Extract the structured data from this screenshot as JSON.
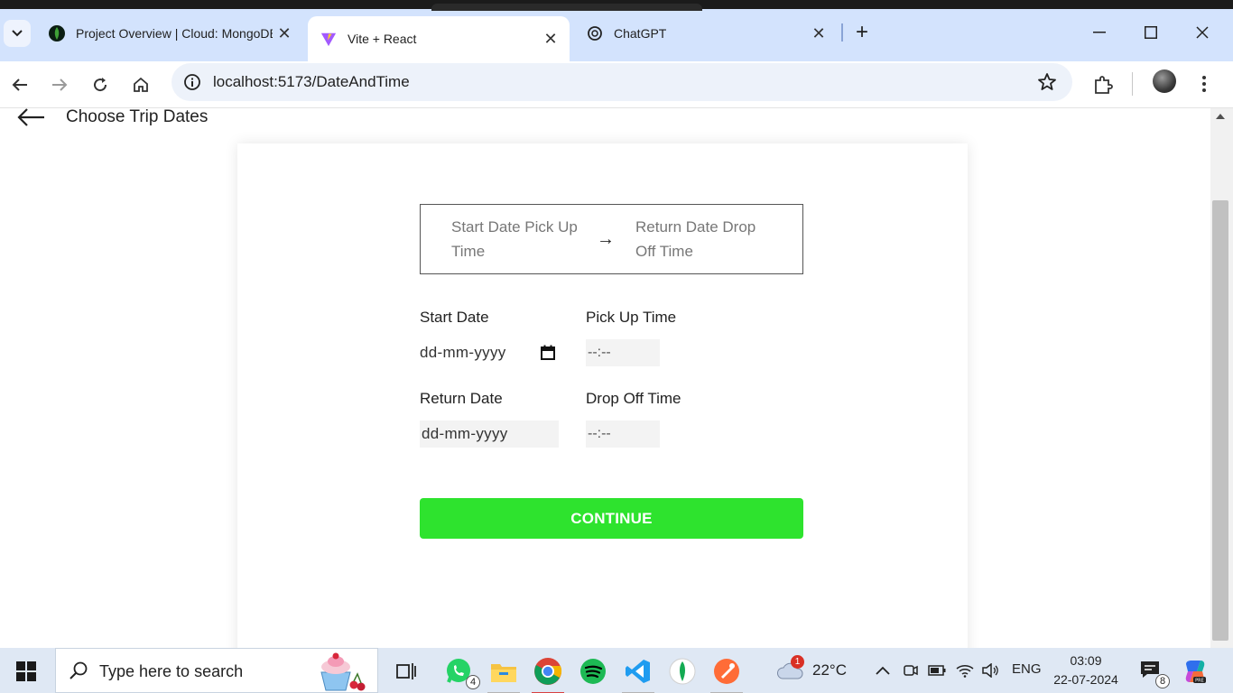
{
  "browser": {
    "tabs": [
      {
        "title": "Project Overview | Cloud: MongoDB",
        "favicon": "mongodb-leaf-icon",
        "active": false
      },
      {
        "title": "Vite + React",
        "favicon": "vite-icon",
        "active": true
      },
      {
        "title": "ChatGPT",
        "favicon": "chatgpt-icon",
        "active": false
      }
    ],
    "url": "localhost:5173/DateAndTime"
  },
  "page": {
    "title": "Choose Trip Dates",
    "steps": {
      "first": "Start Date Pick Up Time",
      "arrow": "→",
      "second": "Return Date Drop Off Time"
    },
    "fields": {
      "start_date_label": "Start Date",
      "start_date_value": "dd-mm-yyyy",
      "pickup_time_label": "Pick Up Time",
      "pickup_time_value": "--:--",
      "return_date_label": "Return Date",
      "return_date_value": "dd-mm-yyyy",
      "dropoff_time_label": "Drop Off Time",
      "dropoff_time_value": "--:--"
    },
    "continue_label": "CONTINUE",
    "colors": {
      "continue_bg": "#2ee32e"
    }
  },
  "taskbar": {
    "search_placeholder": "Type here to search",
    "whatsapp_badge": "4",
    "weather_temp": "22°C",
    "weather_badge": "1",
    "language": "ENG",
    "time": "03:09",
    "date": "22-07-2024",
    "notification_count": "8",
    "apps": [
      "task-view-icon",
      "whatsapp-icon",
      "file-explorer-icon",
      "chrome-icon",
      "spotify-icon",
      "vscode-icon",
      "mongodb-compass-icon",
      "postman-icon"
    ]
  }
}
